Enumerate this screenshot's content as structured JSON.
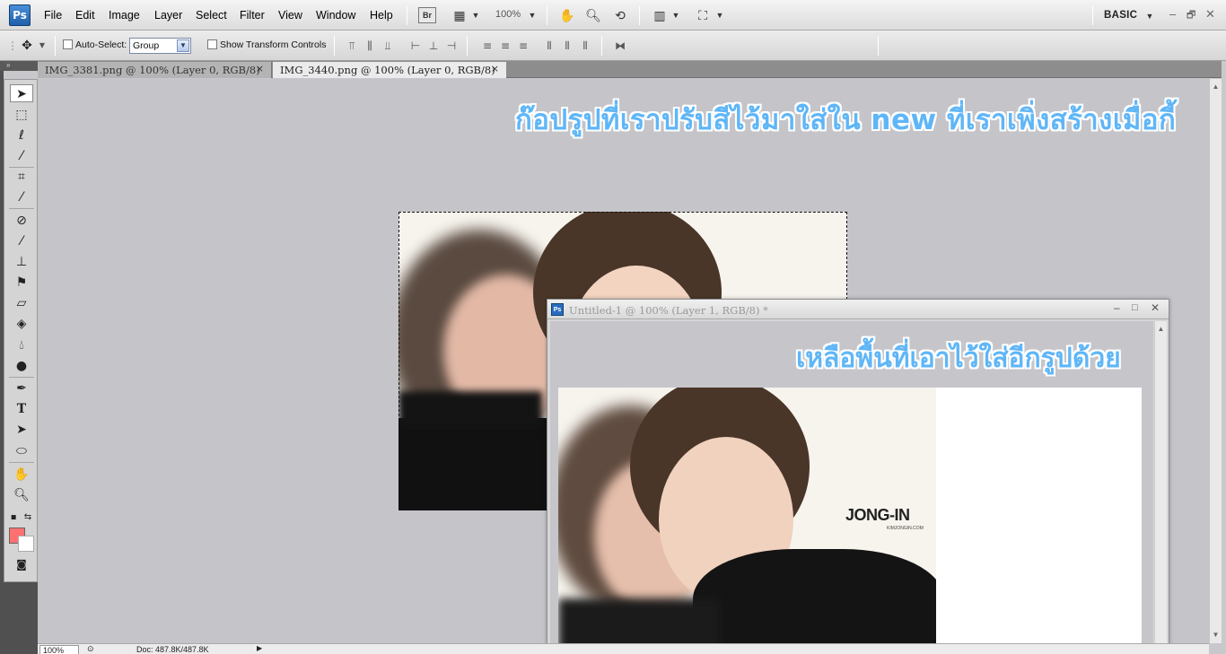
{
  "app": {
    "logo": "Ps",
    "menu": [
      "File",
      "Edit",
      "Image",
      "Layer",
      "Select",
      "Filter",
      "View",
      "Window",
      "Help"
    ],
    "bridge_label": "Br",
    "zoom_level": "100%",
    "workspace": "BASIC",
    "window_controls": [
      "–",
      "🗗",
      "✕"
    ]
  },
  "options_bar": {
    "auto_select_label": "Auto-Select:",
    "auto_select_value": "Group",
    "show_transform_label": "Show Transform Controls"
  },
  "tabs": [
    {
      "label": "IMG_3381.png @ 100% (Layer 0, RGB/8)",
      "close": "×"
    },
    {
      "label": "IMG_3440.png @ 100% (Layer 0, RGB/8)",
      "close": "×"
    }
  ],
  "annotations": {
    "top": "ก๊อปรูปที่เราปรับสีไว้มาใส่ใน  new  ที่เราเพิ่งสร้างเมื่อกี้",
    "inner": "เหลือพื้นที่เอาไว้ใส่อีกรูปด้วย"
  },
  "floating_window": {
    "title": "Untitled-1 @ 100% (Layer 1, RGB/8) *",
    "ps_icon": "Ps"
  },
  "photo": {
    "watermark": "JONG-IN",
    "watermark_sub": "KIMJONGIN.COM"
  },
  "status": {
    "zoom": "100%",
    "doc_info": "Doc: 487.8K/487.8K"
  },
  "colors": {
    "foreground": "#ff7070",
    "background": "#ffffff",
    "annotation": "#5fb6f7"
  }
}
